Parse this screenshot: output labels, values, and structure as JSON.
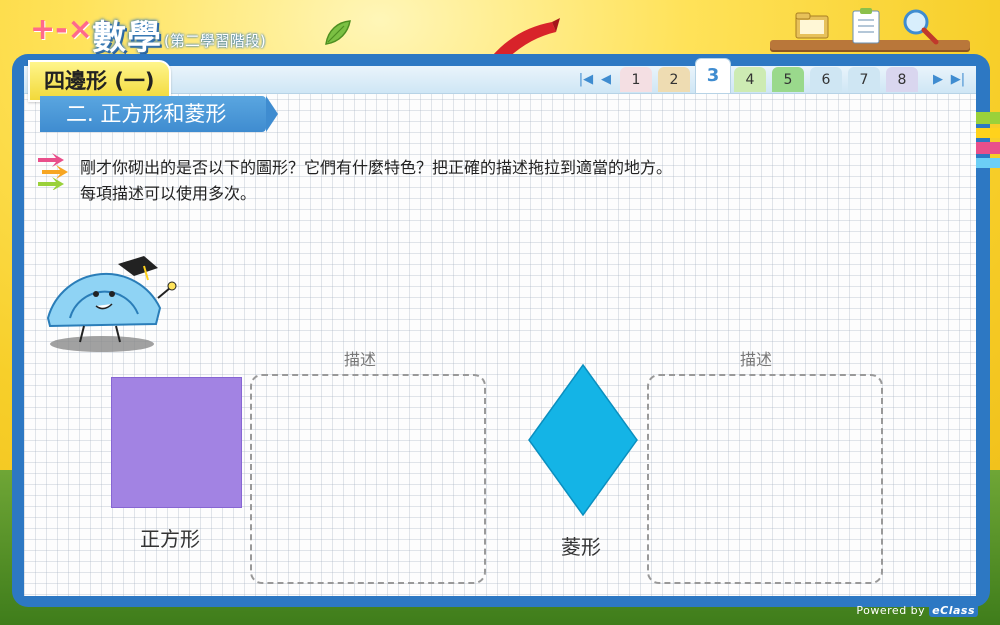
{
  "app": {
    "title": "數學",
    "subtitle": "(第二學習階段)",
    "badge": "+-×÷"
  },
  "chapter": {
    "title": "四邊形 (一)"
  },
  "section": {
    "title": "二. 正方形和菱形"
  },
  "pagination": {
    "pages": [
      "1",
      "2",
      "3",
      "4",
      "5",
      "6",
      "7",
      "8"
    ],
    "current": "3",
    "colors": [
      "#f4dfe3",
      "#eedcb2",
      "#ffffff",
      "#cdebb3",
      "#9ad98c",
      "#cfe6f3",
      "#cfe6f3",
      "#d9d6ef"
    ]
  },
  "instructions": {
    "line1": "剛才你砌出的是否以下的圖形？它們有什麼特色？把正確的描述拖拉到適當的地方。",
    "line2": "每項描述可以使用多次。"
  },
  "shapes": [
    {
      "name": "正方形",
      "color": "#a283e3",
      "drop_label": "描述"
    },
    {
      "name": "菱形",
      "color": "#14b4e6",
      "drop_label": "描述"
    }
  ],
  "toolbar": {
    "icons": [
      "folder-icon",
      "notepad-icon",
      "magnifier-icon"
    ]
  },
  "footer": {
    "powered_by": "Powered by",
    "brand": "eClass"
  }
}
